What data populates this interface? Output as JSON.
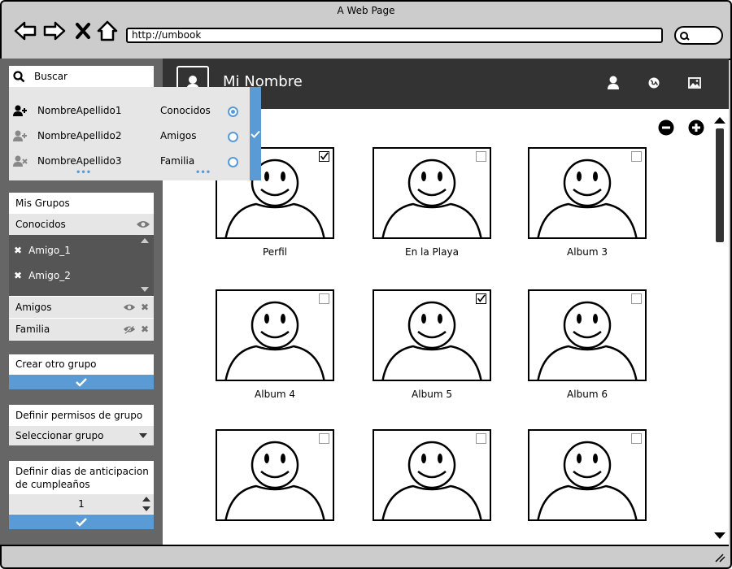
{
  "window": {
    "title": "A Web Page",
    "url": "http://umbook"
  },
  "search": {
    "placeholder": "Buscar"
  },
  "results": [
    {
      "name": "NombreApellido1",
      "icon": "user-add-icon"
    },
    {
      "name": "NombreApellido2",
      "icon": "user-add-icon"
    },
    {
      "name": "NombreApellido3",
      "icon": "user-remove-icon"
    }
  ],
  "group_options": [
    {
      "label": "Conocidos",
      "selected": true
    },
    {
      "label": "Amigos",
      "selected": false
    },
    {
      "label": "Familia",
      "selected": false
    }
  ],
  "sidebar": {
    "mis_grupos_title": "Mis Grupos",
    "groups": [
      {
        "label": "Conocidos"
      },
      {
        "label": "Amigos"
      },
      {
        "label": "Familia"
      }
    ],
    "members": [
      "Amigo_1",
      "Amigo_2"
    ],
    "crear_grupo": "Crear otro grupo",
    "permisos_title": "Definir permisos de grupo",
    "permisos_select": "Seleccionar grupo",
    "anticipacion_title_1": "Definir dias de anticipacion",
    "anticipacion_title_2": "de cumpleaños",
    "anticipacion_value": "1"
  },
  "header": {
    "name": "Mi Nombre"
  },
  "albums": [
    {
      "caption": "Perfil",
      "checked": true
    },
    {
      "caption": "En la Playa",
      "checked": false
    },
    {
      "caption": "Album 3",
      "checked": false
    },
    {
      "caption": "Album 4",
      "checked": false
    },
    {
      "caption": "Album 5",
      "checked": true
    },
    {
      "caption": "Album 6",
      "checked": false
    },
    {
      "caption": "",
      "checked": false
    },
    {
      "caption": "",
      "checked": false
    },
    {
      "caption": "",
      "checked": false
    }
  ],
  "colors": {
    "accent": "#5b9bd5",
    "header_bg": "#333333",
    "sidebar_bg": "#666666"
  }
}
